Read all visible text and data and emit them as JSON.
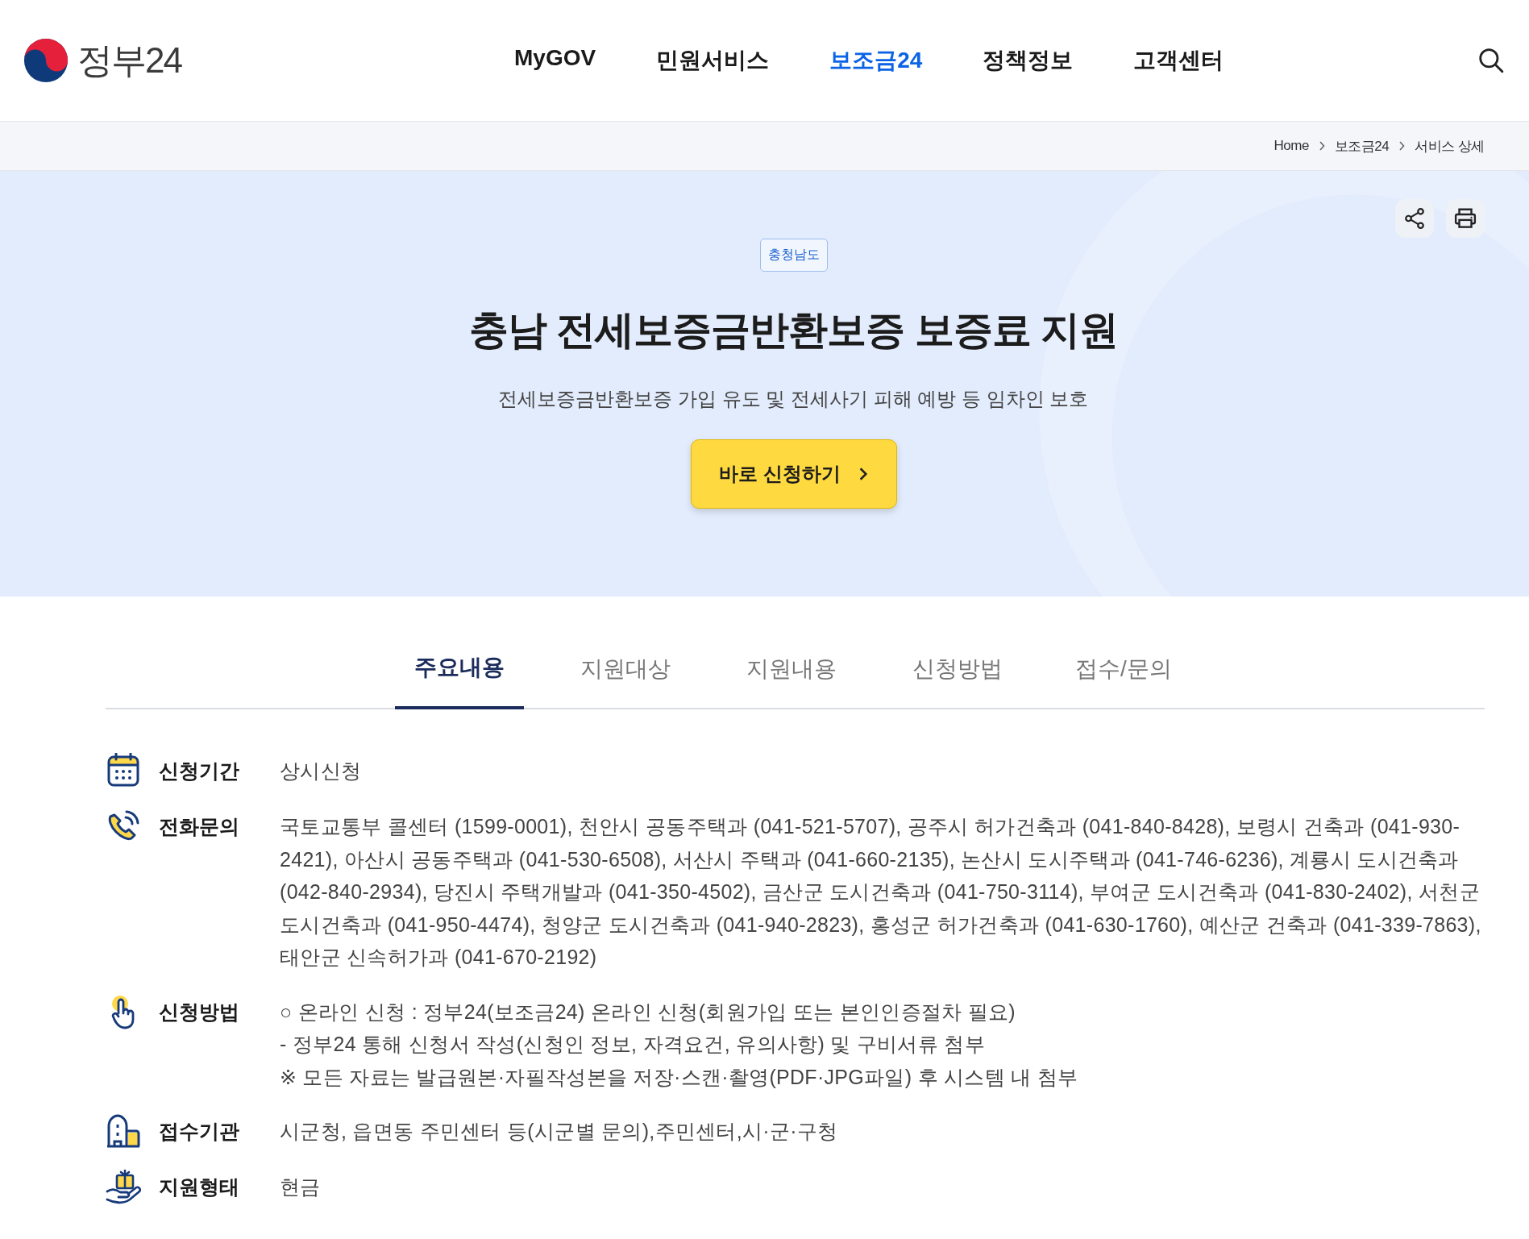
{
  "header": {
    "logo_text": "정부24",
    "nav": [
      {
        "label": "MyGOV",
        "selected": false
      },
      {
        "label": "민원서비스",
        "selected": false
      },
      {
        "label": "보조금24",
        "selected": true
      },
      {
        "label": "정책정보",
        "selected": false
      },
      {
        "label": "고객센터",
        "selected": false
      }
    ]
  },
  "breadcrumb": [
    "Home",
    "보조금24",
    "서비스 상세"
  ],
  "hero": {
    "region_tag": "충청남도",
    "title": "충남 전세보증금반환보증 보증료 지원",
    "subtitle": "전세보증금반환보증 가입 유도 및 전세사기 피해 예방 등 임차인 보호",
    "apply_button": "바로 신청하기"
  },
  "tabs": [
    {
      "label": "주요내용",
      "selected": true
    },
    {
      "label": "지원대상",
      "selected": false
    },
    {
      "label": "지원내용",
      "selected": false
    },
    {
      "label": "신청방법",
      "selected": false
    },
    {
      "label": "접수/문의",
      "selected": false
    }
  ],
  "details": [
    {
      "kind": "calendar",
      "label": "신청기간",
      "lines": [
        "상시신청"
      ]
    },
    {
      "kind": "phone",
      "label": "전화문의",
      "lines": [
        "국토교통부 콜센터 (1599-0001), 천안시 공동주택과 (041-521-5707), 공주시 허가건축과 (041-840-8428), 보령시 건축과 (041-930-2421), 아산시 공동주택과 (041-530-6508), 서산시 주택과 (041-660-2135), 논산시 도시주택과 (041-746-6236), 계룡시 도시건축과 (042-840-2934), 당진시 주택개발과 (041-350-4502), 금산군 도시건축과 (041-750-3114), 부여군 도시건축과 (041-830-2402), 서천군 도시건축과 (041-950-4474), 청양군 도시건축과 (041-940-2823), 홍성군 허가건축과 (041-630-1760), 예산군 건축과 (041-339-7863), 태안군 신속허가과 (041-670-2192)"
      ]
    },
    {
      "kind": "hand",
      "label": "신청방법",
      "lines": [
        "○ 온라인 신청 : 정부24(보조금24) 온라인 신청(회원가입 또는 본인인증절차 필요)",
        "- 정부24 통해 신청서 작성(신청인 정보, 자격요건, 유의사항) 및 구비서류 첨부",
        "※ 모든 자료는 발급원본·자필작성본을 저장·스캔·촬영(PDF·JPG파일) 후 시스템 내 첨부"
      ]
    },
    {
      "kind": "building",
      "label": "접수기관",
      "lines": [
        "시군청, 읍면동 주민센터 등(시군별 문의),주민센터,시·군·구청"
      ]
    },
    {
      "kind": "gift",
      "label": "지원형태",
      "lines": [
        "현금"
      ]
    }
  ]
}
